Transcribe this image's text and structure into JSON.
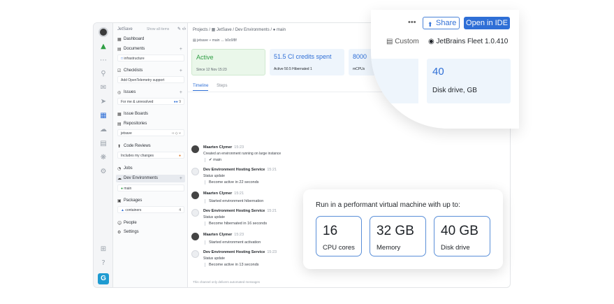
{
  "sidebar": {
    "brand": "JetSave",
    "show_all": "Show all items",
    "tools": "✎ ‹/›",
    "items": [
      {
        "label": "Dashboard",
        "glyph": "▦"
      },
      {
        "label": "Documents",
        "glyph": "▤"
      },
      {
        "label": "Checklists",
        "glyph": "☑"
      },
      {
        "label": "Issues",
        "glyph": "◎"
      },
      {
        "label": "Issue Boards",
        "glyph": "▦"
      },
      {
        "label": "Repositories",
        "glyph": "▤"
      },
      {
        "label": "Code Reviews",
        "glyph": "⬆"
      },
      {
        "label": "Jobs",
        "glyph": "◔"
      },
      {
        "label": "Dev Environments",
        "glyph": "☁"
      },
      {
        "label": "Packages",
        "glyph": "▣"
      },
      {
        "label": "People",
        "glyph": "☺"
      },
      {
        "label": "Settings",
        "glyph": "⚙"
      }
    ],
    "plus": "+",
    "documents_sub": "infrastructure",
    "checklists_sub": "Add OpenTelemetry support",
    "issues_sub": "For me & unresolved",
    "issues_count": "9",
    "repo_sub": "jetsave",
    "repo_tools": "‹› ◇ ⑂",
    "reviews_sub": "Includes my changes",
    "devenv_sub": "main",
    "packages_sub": "containers",
    "packages_count": "4"
  },
  "main": {
    "breadcrumb": "Projects / ▦ JetSave / Dev Environments / ● main",
    "meta": "▤ jetsave   ⑂ main   ↔ b0c6f8f",
    "status_card": {
      "title": "Active",
      "sub": "Since 12 Nov 15:23"
    },
    "credits_card": {
      "title": "51.5 CI credits spent",
      "sub": "Active 50.5    Hibernated 1"
    },
    "cpu_card": {
      "title": "8000",
      "sub": "mCPUs"
    },
    "tabs": [
      "Timeline",
      "Steps"
    ],
    "footer": "This channel only delivers automated messages"
  },
  "timeline": [
    {
      "author": "Maarten Clymer",
      "time": "15:23",
      "text": "Created an environment running on large instance",
      "quote": "✔ main",
      "bot": false
    },
    {
      "author": "Dev Environment Hosting Service",
      "time": "15:21",
      "text": "Status update",
      "quote": "Become active in 22 seconds",
      "bot": true
    },
    {
      "author": "Maarten Clymer",
      "time": "15:21",
      "text": "",
      "quote": "Started environment hibernation",
      "bot": false
    },
    {
      "author": "Dev Environment Hosting Service",
      "time": "15:21",
      "text": "Status update",
      "quote": "Become hibernated in 16 seconds",
      "bot": true
    },
    {
      "author": "Maarten Clymer",
      "time": "15:23",
      "text": "",
      "quote": "Started environment activation",
      "bot": false
    },
    {
      "author": "Dev Environment Hosting Service",
      "time": "15:23",
      "text": "Status update",
      "quote": "Become active in 13 seconds",
      "bot": true
    }
  ],
  "zoom": {
    "dots": "•••",
    "share": "Share",
    "open_ide": "Open in IDE",
    "custom": "Custom",
    "fleet": "JetBrains Fleet 1.0.410",
    "disk_value": "40",
    "disk_label": "Disk drive, GB"
  },
  "callout": {
    "heading": "Run in a performant virtual machine with up to:",
    "specs": [
      {
        "value": "16",
        "label": "CPU cores"
      },
      {
        "value": "32 GB",
        "label": "Memory"
      },
      {
        "value": "40 GB",
        "label": "Disk drive"
      }
    ]
  },
  "colors": {
    "accent": "#2f6fd6",
    "active_green": "#2f9e44",
    "green_bg": "#eaf7ea",
    "blue_bg": "#eef5fc"
  }
}
